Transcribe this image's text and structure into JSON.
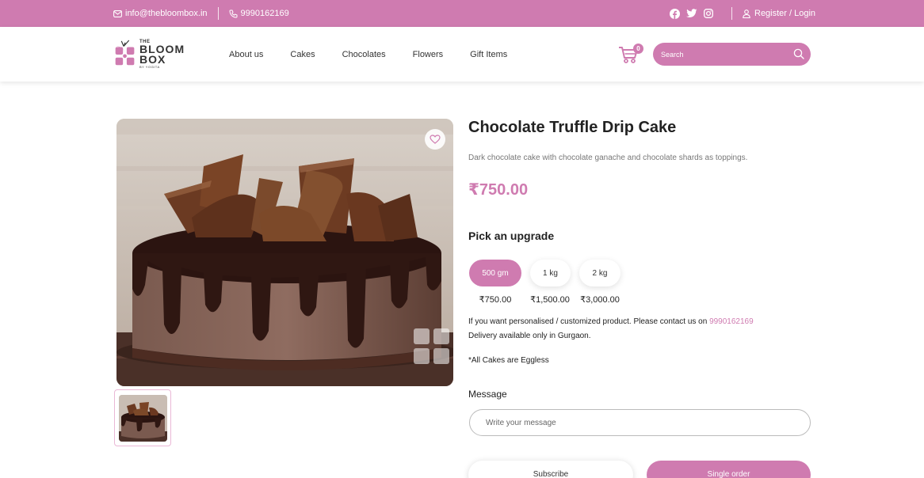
{
  "topbar": {
    "email": "info@thebloombox.in",
    "phone": "9990162169",
    "social_icons": [
      "facebook-icon",
      "twitter-icon",
      "instagram-icon"
    ],
    "login_label": "Register / Login"
  },
  "brand": {
    "line1": "THE",
    "line2": "BLOOM",
    "line3": "BOX",
    "line4": "BY YOGITA"
  },
  "nav": {
    "items": [
      "About us",
      "Cakes",
      "Chocolates",
      "Flowers",
      "Gift Items"
    ]
  },
  "cart": {
    "count": "0"
  },
  "search": {
    "placeholder": "Search"
  },
  "product": {
    "title": "Chocolate Truffle Drip Cake",
    "description": "Dark chocolate cake with chocolate ganache and chocolate shards as toppings.",
    "price": "₹750.00"
  },
  "upgrade": {
    "heading": "Pick an upgrade",
    "options": [
      {
        "label": "500 gm",
        "price": "₹750.00",
        "selected": true
      },
      {
        "label": "1 kg",
        "price": "₹1,500.00",
        "selected": false
      },
      {
        "label": "2 kg",
        "price": "₹3,000.00",
        "selected": false
      }
    ]
  },
  "notes": {
    "custom_text": "If you want personalised / customized product. Please contact us on",
    "custom_phone": "9990162169",
    "delivery": "Delivery available only in Gurgaon.",
    "eggless": "*All Cakes are Eggless"
  },
  "message": {
    "label": "Message",
    "placeholder": "Write your message"
  },
  "actions": {
    "subscribe_label": "Subscribe",
    "single_label": "Single order"
  },
  "colors": {
    "accent": "#cf7bb0"
  }
}
